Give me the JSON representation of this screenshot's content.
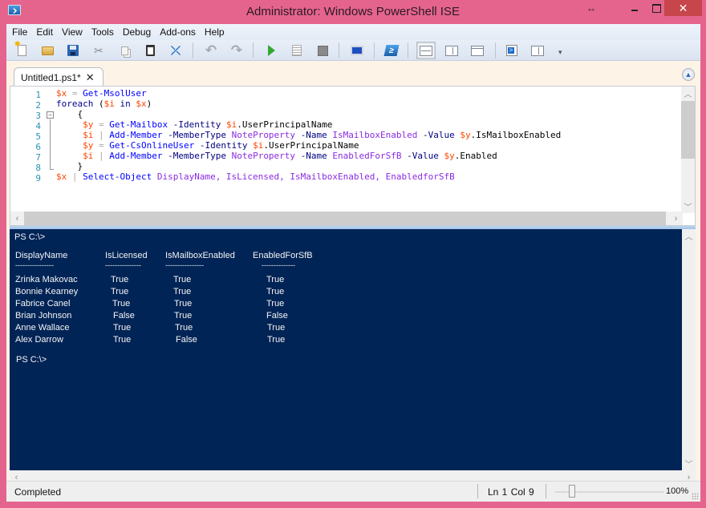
{
  "window": {
    "title": "Administrator: Windows PowerShell ISE",
    "resize_glyph": "↔",
    "close_glyph": "✕"
  },
  "menu": [
    "File",
    "Edit",
    "View",
    "Tools",
    "Debug",
    "Add-ons",
    "Help"
  ],
  "toolbar": {
    "buttons": [
      {
        "name": "new-icon",
        "tooltip": "New"
      },
      {
        "name": "open-icon",
        "tooltip": "Open"
      },
      {
        "name": "save-icon",
        "tooltip": "Save"
      },
      {
        "name": "cut-icon",
        "tooltip": "Cut"
      },
      {
        "name": "copy-icon",
        "tooltip": "Copy"
      },
      {
        "name": "paste-icon",
        "tooltip": "Paste"
      },
      {
        "name": "clear-console-icon",
        "tooltip": "Clear Console Pane"
      },
      {
        "name": "undo-icon",
        "tooltip": "Undo"
      },
      {
        "name": "redo-icon",
        "tooltip": "Redo"
      },
      {
        "name": "run-icon",
        "tooltip": "Run Script"
      },
      {
        "name": "run-selection-icon",
        "tooltip": "Run Selection"
      },
      {
        "name": "stop-icon",
        "tooltip": "Stop Operation"
      },
      {
        "name": "remote-tab-icon",
        "tooltip": "New Remote PowerShell Tab"
      },
      {
        "name": "powershell-console-icon",
        "tooltip": "Start PowerShell.exe"
      },
      {
        "name": "script-pane-top-icon",
        "tooltip": "Show Script Pane Top"
      },
      {
        "name": "script-pane-right-icon",
        "tooltip": "Show Script Pane Right"
      },
      {
        "name": "script-pane-maximized-icon",
        "tooltip": "Show Script Pane Maximized"
      },
      {
        "name": "show-script-pane-icon",
        "tooltip": "Show Script Pane"
      },
      {
        "name": "show-command-addon-icon",
        "tooltip": "Show Command Add-on"
      }
    ],
    "ps_glyph": "≥",
    "cut_glyph": "✂",
    "clear_glyph": "⤫",
    "undo_glyph": "↶",
    "redo_glyph": "↷",
    "overflow_glyph": "▾"
  },
  "tab": {
    "label": "Untitled1.ps1*",
    "close_glyph": "✕",
    "collapse_glyph": "▲"
  },
  "script": {
    "line_numbers": [
      "1",
      "2",
      "3",
      "4",
      "5",
      "6",
      "7",
      "8",
      "9"
    ],
    "fold_glyph": "−",
    "lines": [
      [
        {
          "t": "$x",
          "c": "var"
        },
        {
          "t": " = ",
          "c": "op"
        },
        {
          "t": "Get-MsolUser",
          "c": "cmd"
        }
      ],
      [
        {
          "t": "foreach",
          "c": "kw"
        },
        {
          "t": " (",
          "c": "plain"
        },
        {
          "t": "$i",
          "c": "var"
        },
        {
          "t": " in ",
          "c": "kw"
        },
        {
          "t": "$x",
          "c": "var"
        },
        {
          "t": ")",
          "c": "plain"
        }
      ],
      [
        {
          "t": "    {",
          "c": "plain"
        }
      ],
      [
        {
          "t": "     ",
          "c": "plain"
        },
        {
          "t": "$y",
          "c": "var"
        },
        {
          "t": " = ",
          "c": "op"
        },
        {
          "t": "Get-Mailbox",
          "c": "cmd"
        },
        {
          "t": " -Identity ",
          "c": "param"
        },
        {
          "t": "$i",
          "c": "var"
        },
        {
          "t": ".UserPrincipalName",
          "c": "plain"
        }
      ],
      [
        {
          "t": "     ",
          "c": "plain"
        },
        {
          "t": "$i",
          "c": "var"
        },
        {
          "t": " | ",
          "c": "op"
        },
        {
          "t": "Add-Member",
          "c": "cmd"
        },
        {
          "t": " -MemberType ",
          "c": "param"
        },
        {
          "t": "NoteProperty",
          "c": "str"
        },
        {
          "t": " -Name ",
          "c": "param"
        },
        {
          "t": "IsMailboxEnabled",
          "c": "str"
        },
        {
          "t": " -Value ",
          "c": "param"
        },
        {
          "t": "$y",
          "c": "var"
        },
        {
          "t": ".IsMailboxEnabled",
          "c": "plain"
        }
      ],
      [
        {
          "t": "     ",
          "c": "plain"
        },
        {
          "t": "$y",
          "c": "var"
        },
        {
          "t": " = ",
          "c": "op"
        },
        {
          "t": "Get-CsOnlineUser",
          "c": "cmd"
        },
        {
          "t": " -Identity ",
          "c": "param"
        },
        {
          "t": "$i",
          "c": "var"
        },
        {
          "t": ".UserPrincipalName",
          "c": "plain"
        }
      ],
      [
        {
          "t": "     ",
          "c": "plain"
        },
        {
          "t": "$i",
          "c": "var"
        },
        {
          "t": " | ",
          "c": "op"
        },
        {
          "t": "Add-Member",
          "c": "cmd"
        },
        {
          "t": " -MemberType ",
          "c": "param"
        },
        {
          "t": "NoteProperty",
          "c": "str"
        },
        {
          "t": " -Name ",
          "c": "param"
        },
        {
          "t": "EnabledForSfB",
          "c": "str"
        },
        {
          "t": " -Value ",
          "c": "param"
        },
        {
          "t": "$y",
          "c": "var"
        },
        {
          "t": ".Enabled",
          "c": "plain"
        }
      ],
      [
        {
          "t": "    }",
          "c": "plain"
        }
      ],
      [
        {
          "t": "$x",
          "c": "var"
        },
        {
          "t": " | ",
          "c": "op"
        },
        {
          "t": "Select-Object",
          "c": "cmd"
        },
        {
          "t": " DisplayName, IsLicensed, IsMailboxEnabled, EnabledforSfB",
          "c": "str"
        }
      ]
    ]
  },
  "console": {
    "prompt_first": "PS C:\\>",
    "headers": [
      "DisplayName",
      "IsLicensed",
      "IsMailboxEnabled",
      "EnabledForSfB"
    ],
    "header_underlines": [
      "----------------",
      "---------------",
      "----------------",
      "--------------"
    ],
    "rows": [
      [
        "Zrinka Makovac",
        "True",
        "True",
        "True"
      ],
      [
        "Bonnie Kearney",
        "True",
        "True",
        "True"
      ],
      [
        "Fabrice Canel",
        "True",
        "True",
        "True"
      ],
      [
        "Brian Johnson",
        "False",
        "True",
        "False"
      ],
      [
        "Anne Wallace",
        "True",
        "True",
        "True"
      ],
      [
        "Alex Darrow",
        "True",
        "False",
        "True"
      ]
    ],
    "prompt_last": "PS C:\\>"
  },
  "statusbar": {
    "status": "Completed",
    "cursor_position": "Ln 1  Col 9",
    "zoom_level": "100%",
    "zoom_fraction": 0.2
  },
  "scroll": {
    "up_glyph": "︿",
    "down_glyph": "﹀",
    "left_glyph": "‹",
    "right_glyph": "›"
  },
  "colors": {
    "window_frame": "#e5648e",
    "console_background": "#012456",
    "token_variable": "#ff4500",
    "token_command": "#0000ff",
    "token_keyword": "#00008b",
    "token_string": "#8a2be2",
    "line_number": "#2b91af"
  }
}
